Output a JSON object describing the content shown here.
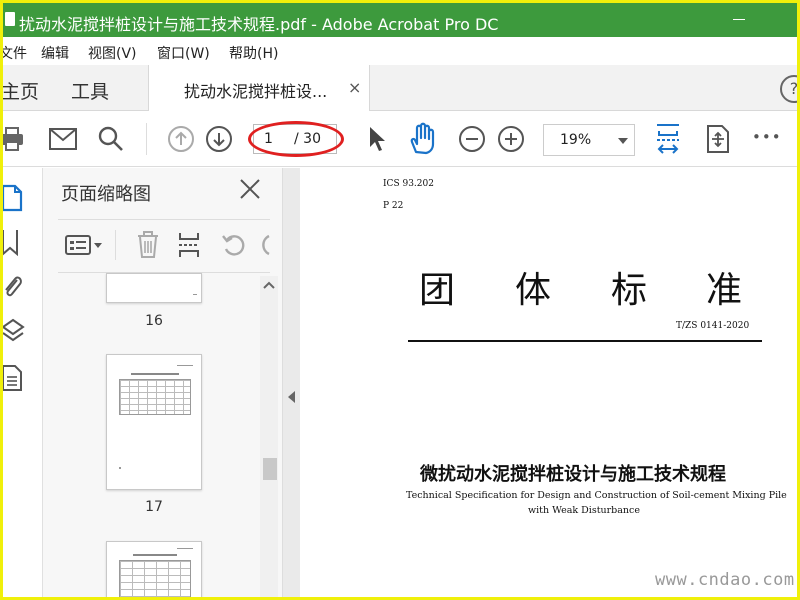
{
  "window": {
    "title": "扰动水泥搅拌桩设计与施工技术规程.pdf - Adobe Acrobat Pro DC",
    "minimize_glyph": "—"
  },
  "menu": {
    "items": [
      "文件",
      "编辑",
      "视图(V)",
      "窗口(W)",
      "帮助(H)"
    ]
  },
  "tabs": {
    "home": "主页",
    "tools": "工具",
    "document": "扰动水泥搅拌桩设...",
    "close_glyph": "×",
    "help_glyph": "?"
  },
  "toolbar": {
    "page_current": "1",
    "page_total": "/ 30",
    "zoom": "19%",
    "more_glyph": "•••",
    "icons": [
      "print-icon",
      "email-icon",
      "search-icon",
      "previous-page-icon",
      "next-page-icon",
      "select-cursor-icon",
      "hand-icon",
      "zoom-out-icon",
      "zoom-in-icon",
      "fit-page-icon",
      "scroll-mode-icon",
      "more-icon"
    ],
    "annotation_color": "#e02020",
    "hand_color": "#1a73c9"
  },
  "rail": {
    "icons": [
      "pages-icon",
      "bookmark-icon",
      "attachment-icon",
      "layers-icon",
      "document-icon"
    ],
    "active_color": "#1a73c9"
  },
  "thumbnails_panel": {
    "title": "页面缩略图",
    "pages": [
      {
        "label": "16"
      },
      {
        "label": "17"
      }
    ]
  },
  "document": {
    "ics": "ICS 93.202",
    "p_code": "P 22",
    "heading": [
      "团",
      "体",
      "标",
      "准"
    ],
    "standard_number": "T/ZS 0141-2020",
    "title_cn": "微扰动水泥搅拌桩设计与施工技术规程",
    "title_en_line1": "Technical Specification for Design and Construction of Soil-cement Mixing Pile",
    "title_en_line2": "with Weak Disturbance"
  },
  "watermark": "www.cndao.com",
  "colors": {
    "titlebar_bg": "#3d9a3d",
    "screen_border": "#f0f00a",
    "accent_blue": "#1a73c9"
  }
}
